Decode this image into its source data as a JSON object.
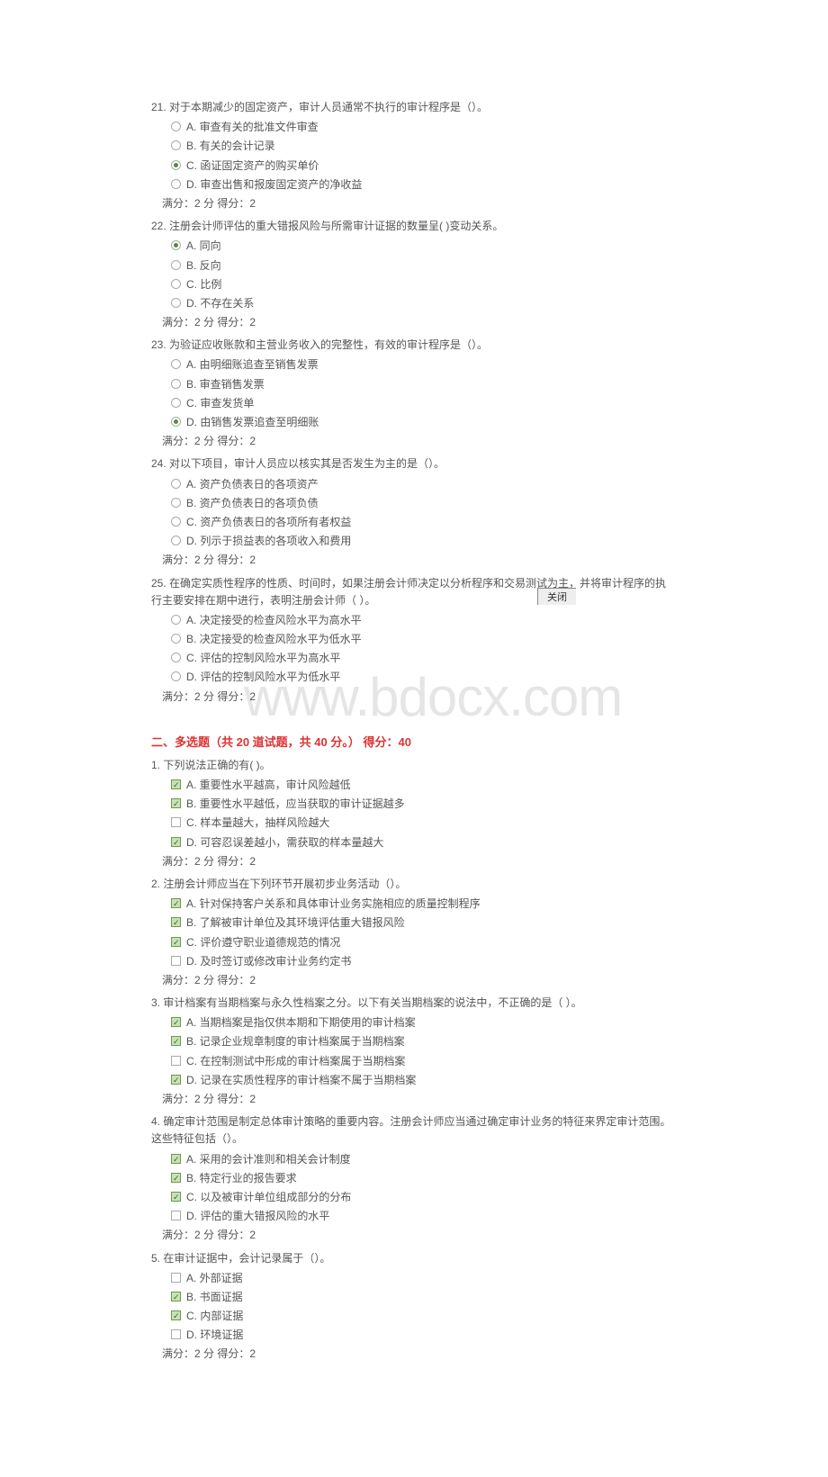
{
  "watermark": "www.bdocx.com",
  "close_label": "关闭",
  "score_line": "满分：2 分  得分：2",
  "section1": {
    "questions": [
      {
        "num": "21.",
        "stem": "对于本期减少的固定资产，审计人员通常不执行的审计程序是（）。",
        "opts": [
          {
            "k": "A",
            "txt": "审查有关的批准文件审查",
            "sel": false
          },
          {
            "k": "B",
            "txt": "有关的会计记录",
            "sel": false
          },
          {
            "k": "C",
            "txt": "函证固定资产的购买单价",
            "sel": true
          },
          {
            "k": "D",
            "txt": "审查出售和报废固定资产的净收益",
            "sel": false
          }
        ]
      },
      {
        "num": "22.",
        "stem": "注册会计师评估的重大错报风险与所需审计证据的数量呈( )变动关系。",
        "opts": [
          {
            "k": "A",
            "txt": "同向",
            "sel": true
          },
          {
            "k": "B",
            "txt": "反向",
            "sel": false
          },
          {
            "k": "C",
            "txt": "比例",
            "sel": false
          },
          {
            "k": "D",
            "txt": "不存在关系",
            "sel": false
          }
        ]
      },
      {
        "num": "23.",
        "stem": "为验证应收账款和主营业务收入的完整性，有效的审计程序是（）。",
        "opts": [
          {
            "k": "A",
            "txt": "由明细账追查至销售发票",
            "sel": false
          },
          {
            "k": "B",
            "txt": "审查销售发票",
            "sel": false
          },
          {
            "k": "C",
            "txt": "审查发货单",
            "sel": false
          },
          {
            "k": "D",
            "txt": "由销售发票追查至明细账",
            "sel": true
          }
        ]
      },
      {
        "num": "24.",
        "stem": "对以下项目，审计人员应以核实其是否发生为主的是（）。",
        "opts": [
          {
            "k": "A",
            "txt": "资产负债表日的各项资产",
            "sel": false
          },
          {
            "k": "B",
            "txt": "资产负债表日的各项负债",
            "sel": false
          },
          {
            "k": "C",
            "txt": "资产负债表日的各项所有者权益",
            "sel": false
          },
          {
            "k": "D",
            "txt": "列示于损益表的各项收入和费用",
            "sel": false
          }
        ]
      },
      {
        "num": "25.",
        "stem": "在确定实质性程序的性质、时间时，如果注册会计师决定以分析程序和交易测试为主，并将审计程序的执行主要安排在期中进行，表明注册会计师（  ）。",
        "opts": [
          {
            "k": "A",
            "txt": "决定接受的检查风险水平为高水平",
            "sel": false
          },
          {
            "k": "B",
            "txt": "决定接受的检查风险水平为低水平",
            "sel": false
          },
          {
            "k": "C",
            "txt": "评估的控制风险水平为高水平",
            "sel": false
          },
          {
            "k": "D",
            "txt": "评估的控制风险水平为低水平",
            "sel": false
          }
        ]
      }
    ]
  },
  "section2": {
    "header": "二、多选题（共 20 道试题，共 40 分。）    得分：40",
    "questions": [
      {
        "num": "1.",
        "stem": "下列说法正确的有( )。",
        "opts": [
          {
            "k": "A",
            "txt": "重要性水平越高，审计风险越低",
            "sel": true
          },
          {
            "k": "B",
            "txt": "重要性水平越低，应当获取的审计证据越多",
            "sel": true
          },
          {
            "k": "C",
            "txt": "样本量越大，抽样风险越大",
            "sel": false
          },
          {
            "k": "D",
            "txt": "可容忍误差越小，需获取的样本量越大",
            "sel": true
          }
        ]
      },
      {
        "num": "2.",
        "stem": "注册会计师应当在下列环节开展初步业务活动（）。",
        "opts": [
          {
            "k": "A",
            "txt": "针对保持客户关系和具体审计业务实施相应的质量控制程序",
            "sel": true
          },
          {
            "k": "B",
            "txt": "了解被审计单位及其环境评估重大错报风险",
            "sel": true
          },
          {
            "k": "C",
            "txt": "评价遵守职业道德规范的情况",
            "sel": true
          },
          {
            "k": "D",
            "txt": "及时签订或修改审计业务约定书",
            "sel": false
          }
        ]
      },
      {
        "num": "3.",
        "stem": "审计档案有当期档案与永久性档案之分。以下有关当期档案的说法中，不正确的是（  ）。",
        "opts": [
          {
            "k": "A",
            "txt": "当期档案是指仅供本期和下期使用的审计档案",
            "sel": true
          },
          {
            "k": "B",
            "txt": "记录企业规章制度的审计档案属于当期档案",
            "sel": true
          },
          {
            "k": "C",
            "txt": "在控制测试中形成的审计档案属于当期档案",
            "sel": false
          },
          {
            "k": "D",
            "txt": "记录在实质性程序的审计档案不属于当期档案",
            "sel": true
          }
        ]
      },
      {
        "num": "4.",
        "stem": "确定审计范围是制定总体审计策略的重要内容。注册会计师应当通过确定审计业务的特征来界定审计范围。这些特征包括（）。",
        "opts": [
          {
            "k": "A",
            "txt": "采用的会计准则和相关会计制度",
            "sel": true
          },
          {
            "k": "B",
            "txt": "特定行业的报告要求",
            "sel": true
          },
          {
            "k": "C",
            "txt": "以及被审计单位组成部分的分布",
            "sel": true
          },
          {
            "k": "D",
            "txt": "评估的重大错报风险的水平",
            "sel": false
          }
        ]
      },
      {
        "num": "5.",
        "stem": "在审计证据中，会计记录属于（）。",
        "opts": [
          {
            "k": "A",
            "txt": "外部证据",
            "sel": false
          },
          {
            "k": "B",
            "txt": "书面证据",
            "sel": true
          },
          {
            "k": "C",
            "txt": "内部证据",
            "sel": true
          },
          {
            "k": "D",
            "txt": "环境证据",
            "sel": false
          }
        ]
      }
    ]
  }
}
